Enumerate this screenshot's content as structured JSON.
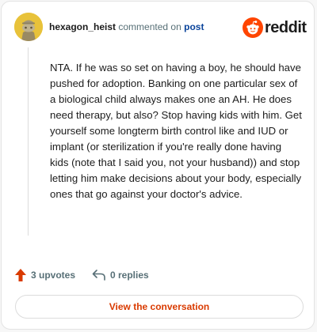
{
  "header": {
    "username": "hexagon_heist",
    "action_text": "commented on",
    "post_link": "post",
    "brand_name": "reddit",
    "brand_color": "#ff4500"
  },
  "comment": {
    "body": "NTA. If he was so set on having a boy, he should have pushed for adoption. Banking on one particular sex of a biological child always makes one an AH. He does need therapy, but also? Stop having kids with him. Get yourself some longterm birth control like and IUD or implant (or sterilization if you're really done having kids (note that I said you, not your husband)) and stop letting him make decisions about your body, especially ones that go against your doctor's advice."
  },
  "actions": {
    "upvotes_label": "3 upvotes",
    "replies_label": "0 replies",
    "upvote_icon": "arrow-up-icon",
    "reply_icon": "reply-arrow-icon"
  },
  "footer": {
    "view_conversation_label": "View the conversation"
  }
}
